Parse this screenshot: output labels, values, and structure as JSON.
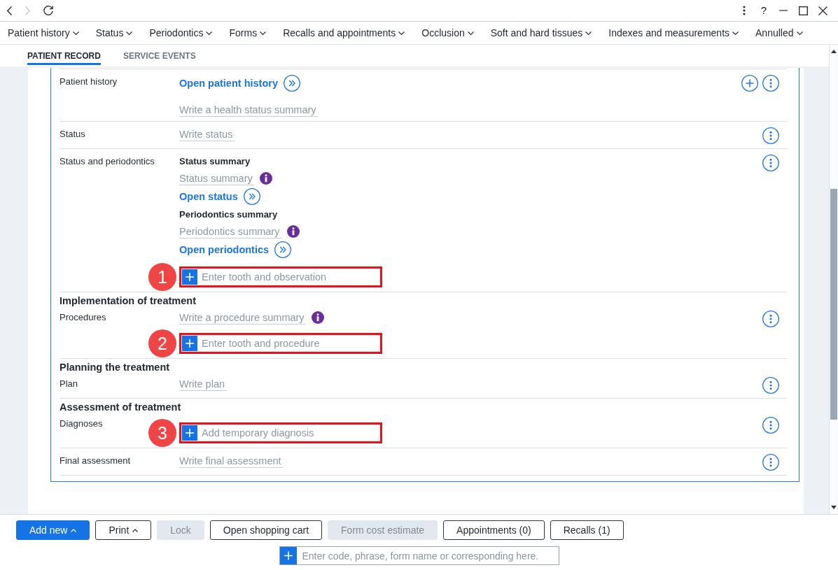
{
  "navigation": [
    {
      "kind": "back",
      "disabled": false
    },
    {
      "kind": "forward",
      "disabled": true
    },
    {
      "kind": "reload",
      "disabled": false
    }
  ],
  "window_controls": [
    {
      "kind": "more"
    },
    {
      "kind": "help",
      "label": "?"
    },
    {
      "kind": "minimize"
    },
    {
      "kind": "maximize"
    },
    {
      "kind": "close"
    }
  ],
  "menu": [
    "Patient history",
    "Status",
    "Periodontics",
    "Forms",
    "Recalls and appointments",
    "Occlusion",
    "Soft and hard tissues",
    "Indexes and measurements",
    "Annulled"
  ],
  "tabs": [
    {
      "label": "PATIENT RECORD",
      "selected": true
    },
    {
      "label": "SERVICE EVENTS",
      "selected": false
    }
  ],
  "record": {
    "sections": [
      {
        "rows": [
          {
            "label": "Patient history",
            "actions": [
              {
                "kind": "add"
              },
              {
                "kind": "more"
              }
            ],
            "items": [
              {
                "kind": "link",
                "text": "Open patient history"
              },
              {
                "kind": "summary",
                "placeholder": "Write a health status summary"
              }
            ]
          },
          {
            "label": "Status",
            "actions": [
              {
                "kind": "more"
              }
            ],
            "items": [
              {
                "kind": "summary",
                "placeholder": "Write status"
              }
            ]
          },
          {
            "label": "Status and periodontics",
            "actions": [
              {
                "kind": "more"
              }
            ],
            "items": [
              {
                "kind": "subheading",
                "text": "Status summary"
              },
              {
                "kind": "summary",
                "placeholder": "Status summary",
                "info": true
              },
              {
                "kind": "link",
                "text": "Open status"
              },
              {
                "kind": "subheading",
                "text": "Periodontics summary"
              },
              {
                "kind": "summary",
                "placeholder": "Periodontics summary",
                "info": true
              },
              {
                "kind": "link",
                "text": "Open periodontics"
              },
              {
                "kind": "entry",
                "placeholder": "Enter tooth and observation",
                "callout": "1"
              }
            ]
          }
        ]
      },
      {
        "heading": "Implementation of treatment",
        "rows": [
          {
            "label": "Procedures",
            "actions": [
              {
                "kind": "more"
              }
            ],
            "items": [
              {
                "kind": "summary",
                "placeholder": "Write a procedure summary",
                "info": true
              },
              {
                "kind": "entry",
                "placeholder": "Enter tooth and procedure",
                "callout": "2"
              }
            ]
          }
        ]
      },
      {
        "heading": "Planning the treatment",
        "rows": [
          {
            "label": "Plan",
            "actions": [
              {
                "kind": "more"
              }
            ],
            "items": [
              {
                "kind": "summary",
                "placeholder": "Write plan"
              }
            ]
          }
        ]
      },
      {
        "heading": "Assessment of treatment",
        "rows": [
          {
            "label": "Diagnoses",
            "actions": [
              {
                "kind": "more"
              }
            ],
            "items": [
              {
                "kind": "entry",
                "placeholder": "Add temporary diagnosis",
                "callout": "3"
              }
            ]
          },
          {
            "label": "Final assessment",
            "actions": [
              {
                "kind": "more"
              }
            ],
            "items": [
              {
                "kind": "summary",
                "placeholder": "Write final assessment"
              }
            ]
          }
        ]
      }
    ]
  },
  "footer": {
    "buttons": [
      {
        "label": "Add new",
        "kind": "primary",
        "menu": true,
        "disabled": false
      },
      {
        "label": "Print",
        "kind": "default",
        "menu": true,
        "disabled": false
      },
      {
        "label": "Lock",
        "kind": "default",
        "menu": false,
        "disabled": true
      },
      {
        "label": "Open shopping cart",
        "kind": "default",
        "menu": false,
        "disabled": false
      },
      {
        "label": "Form cost estimate",
        "kind": "default",
        "menu": false,
        "disabled": true
      },
      {
        "label": "Appointments (0)",
        "kind": "default",
        "menu": false,
        "disabled": false
      },
      {
        "label": "Recalls (1)",
        "kind": "default",
        "menu": false,
        "disabled": false
      }
    ],
    "command_field": {
      "placeholder": "Enter code, phrase, form name or corresponding here."
    }
  }
}
